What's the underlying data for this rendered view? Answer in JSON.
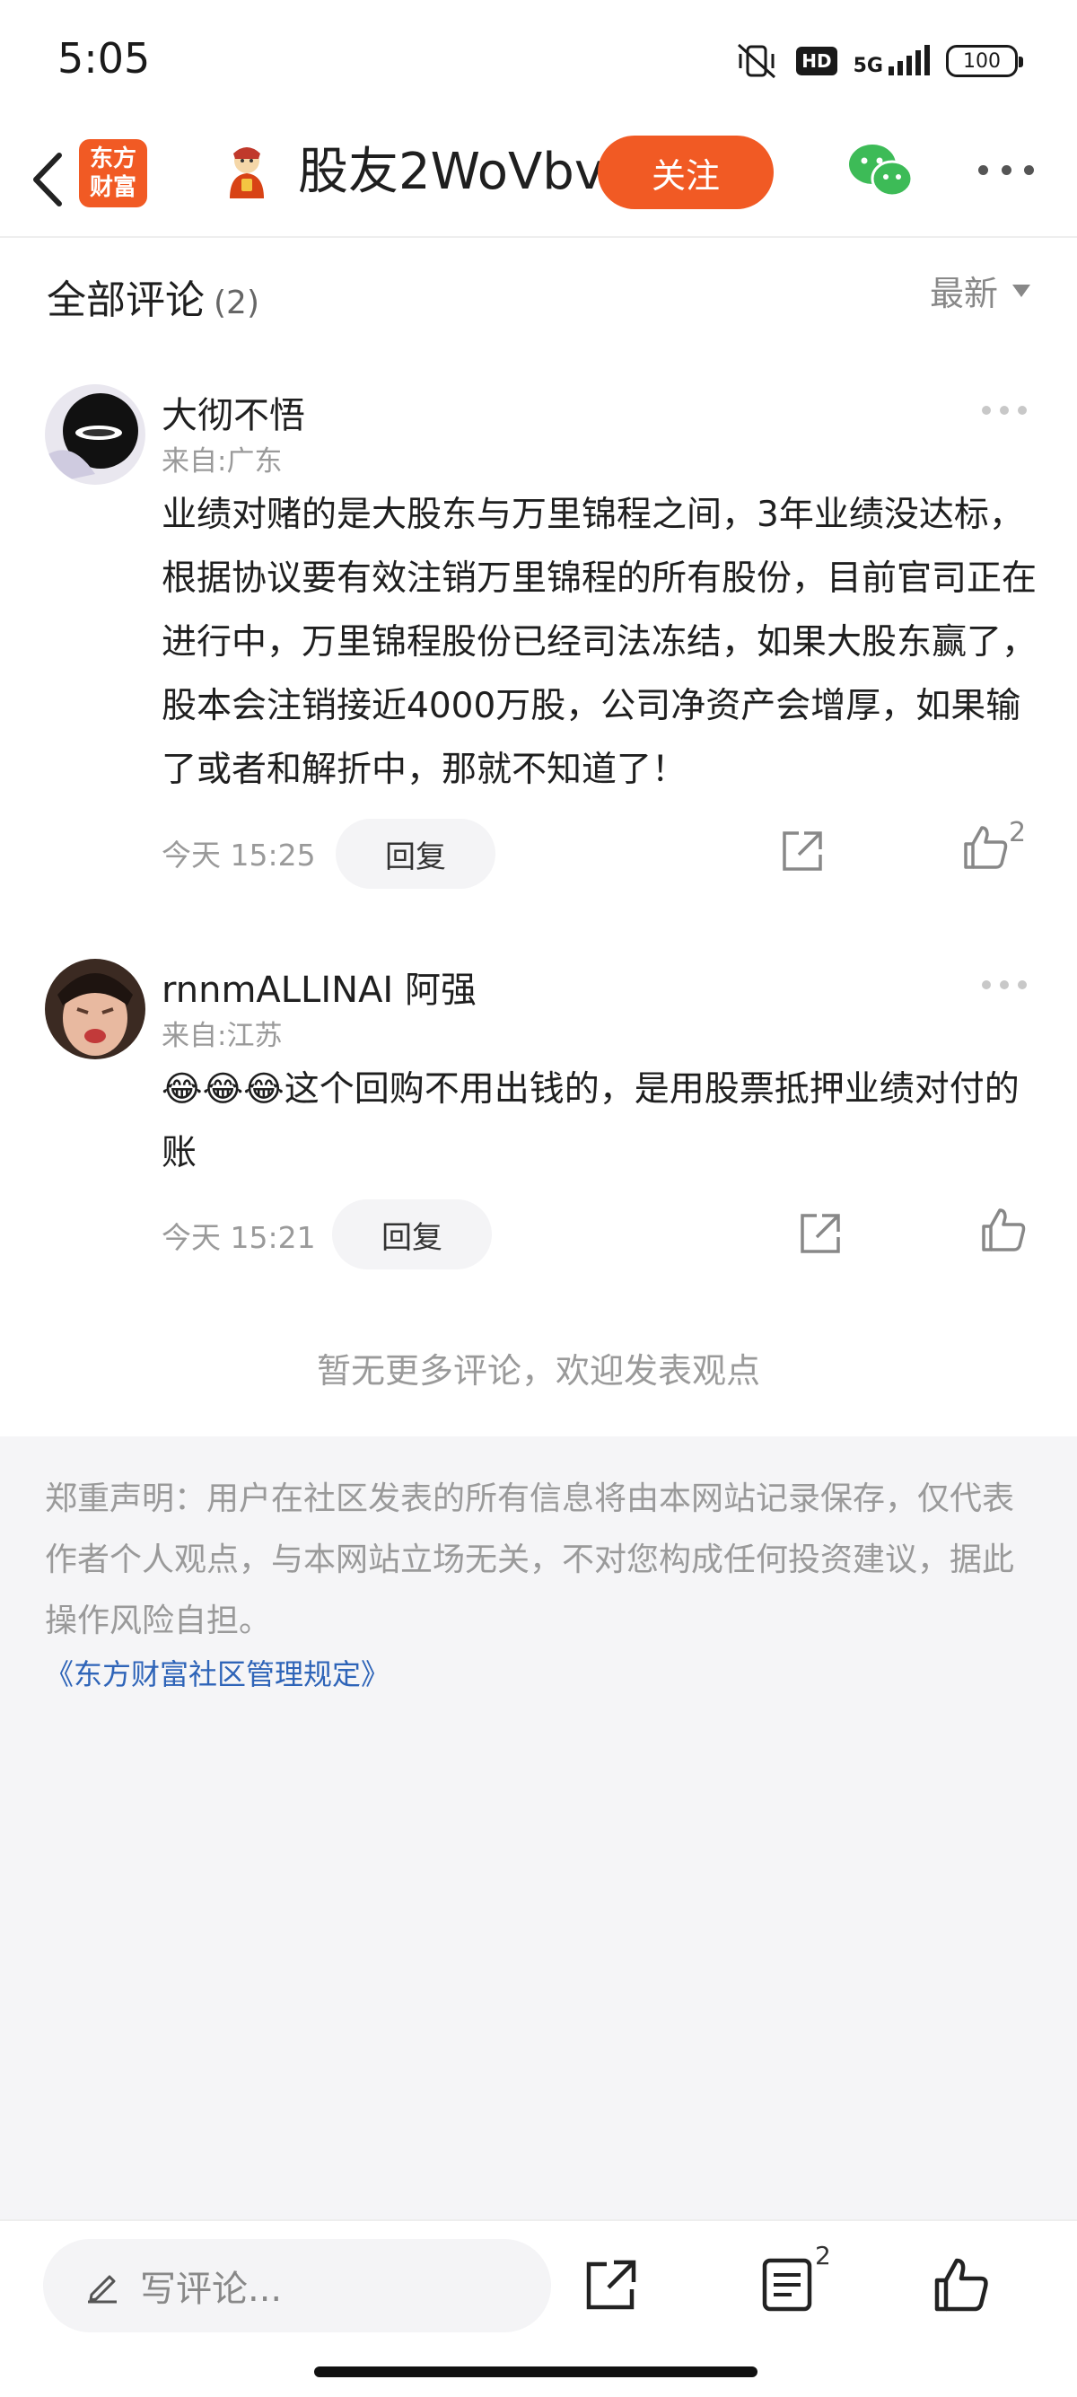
{
  "status_bar": {
    "time": "5:05",
    "hd": "HD",
    "network": "5G",
    "battery": "100"
  },
  "header": {
    "app_logo_line1": "东方",
    "app_logo_line2": "财富",
    "user_name": "股友2WoVbv",
    "follow_label": "关注"
  },
  "comments_section": {
    "title": "全部评论",
    "count": "(2)",
    "sort_label": "最新"
  },
  "comments": [
    {
      "name": "大彻不悟",
      "location": "来自:广东",
      "text": "业绩对赌的是大股东与万里锦程之间，3年业绩没达标，根据协议要有效注销万里锦程的所有股份，目前官司正在进行中，万里锦程股份已经司法冻结，如果大股东赢了，股本会注销接近4000万股，公司净资产会增厚，如果输了或者和解折中，那就不知道了！",
      "time": "今天 15:25",
      "reply_label": "回复",
      "likes": "2"
    },
    {
      "name": "rnnmALLINAI 阿强",
      "location": "来自:江苏",
      "emoji": "😂😂😂",
      "text": "这个回购不用出钱的，是用股票抵押业绩对付的账",
      "time": "今天 15:21",
      "reply_label": "回复",
      "likes": ""
    }
  ],
  "no_more_text": "暂无更多评论，欢迎发表观点",
  "disclaimer": {
    "text": "郑重声明：用户在社区发表的所有信息将由本网站记录保存，仅代表作者个人观点，与本网站立场无关，不对您构成任何投资建议，据此操作风险自担。",
    "link": "《东方财富社区管理规定》"
  },
  "bottom_bar": {
    "input_placeholder": "写评论...",
    "comment_count": "2"
  },
  "colors": {
    "brand": "#f15a24",
    "link": "#2e64b8",
    "wechat": "#3dbb57"
  }
}
